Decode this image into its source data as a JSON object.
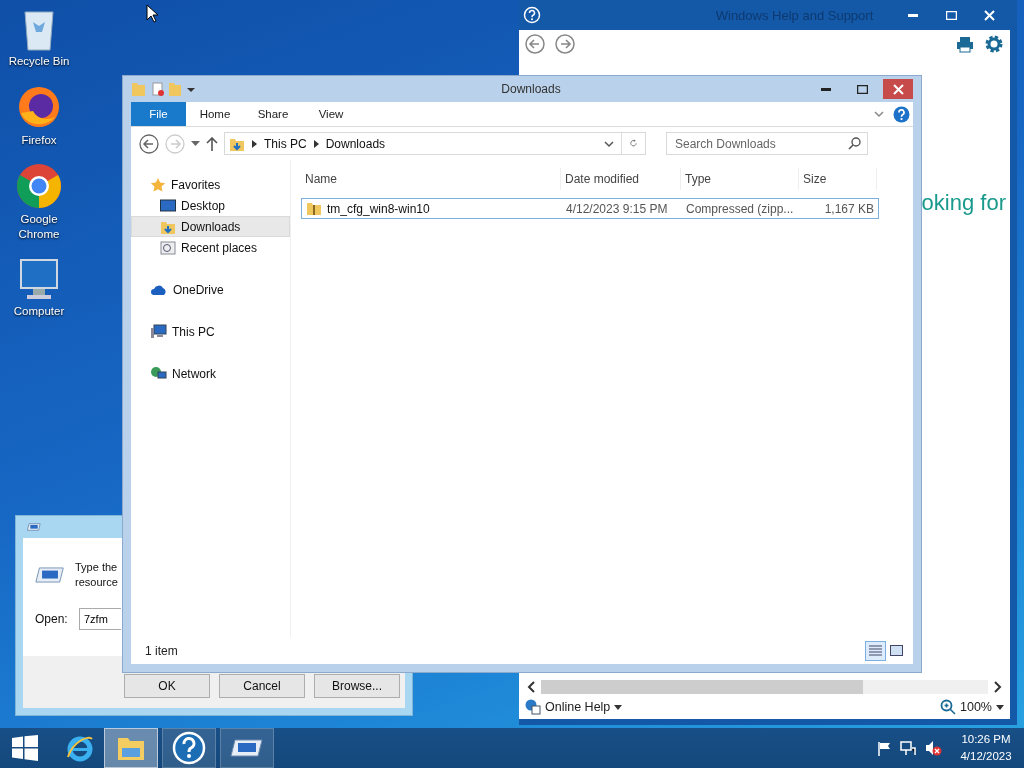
{
  "desktop_icons": [
    {
      "label": "Recycle Bin",
      "kind": "recycle"
    },
    {
      "label": "Firefox",
      "kind": "firefox"
    },
    {
      "label": "Google Chrome",
      "kind": "chrome"
    },
    {
      "label": "Computer",
      "kind": "computer"
    }
  ],
  "help_window": {
    "title": "Windows Help and Support",
    "body_text": "oking for",
    "online_help": "Online Help",
    "zoom": "100%"
  },
  "run_dialog": {
    "prompt_lines": [
      "Type the",
      "resource"
    ],
    "open_label": "Open:",
    "open_value": "7zfm",
    "buttons": [
      "OK",
      "Cancel",
      "Browse..."
    ]
  },
  "explorer": {
    "title": "Downloads",
    "ribbon_tabs": [
      {
        "label": "File",
        "kind": "file"
      },
      {
        "label": "Home",
        "kind": "tab"
      },
      {
        "label": "Share",
        "kind": "tab"
      },
      {
        "label": "View",
        "kind": "tab"
      }
    ],
    "breadcrumb": [
      "This PC",
      "Downloads"
    ],
    "search": {
      "placeholder": "Search Downloads"
    },
    "nav": [
      {
        "label": "Favorites",
        "kind": "favorites",
        "selected": false,
        "children": [
          {
            "label": "Desktop",
            "kind": "desktop",
            "selected": false
          },
          {
            "label": "Downloads",
            "kind": "downloads",
            "selected": true
          },
          {
            "label": "Recent places",
            "kind": "recent",
            "selected": false
          }
        ]
      },
      {
        "label": "OneDrive",
        "kind": "onedrive",
        "selected": false
      },
      {
        "label": "This PC",
        "kind": "pc",
        "selected": false
      },
      {
        "label": "Network",
        "kind": "network",
        "selected": false
      }
    ],
    "columns": [
      "Name",
      "Date modified",
      "Type",
      "Size"
    ],
    "rows": [
      {
        "name": "tm_cfg_win8-win10",
        "date": "4/12/2023 9:15 PM",
        "type": "Compressed (zipp...",
        "size": "1,167 KB",
        "selected": true
      }
    ],
    "status": "1 item"
  },
  "taskbar": {
    "apps": [
      {
        "kind": "ie",
        "selected": false
      },
      {
        "kind": "explorer",
        "selected": true
      },
      {
        "kind": "help",
        "selected": false
      },
      {
        "kind": "run",
        "selected": false
      }
    ],
    "time": "10:26 PM",
    "date": "4/12/2023"
  }
}
